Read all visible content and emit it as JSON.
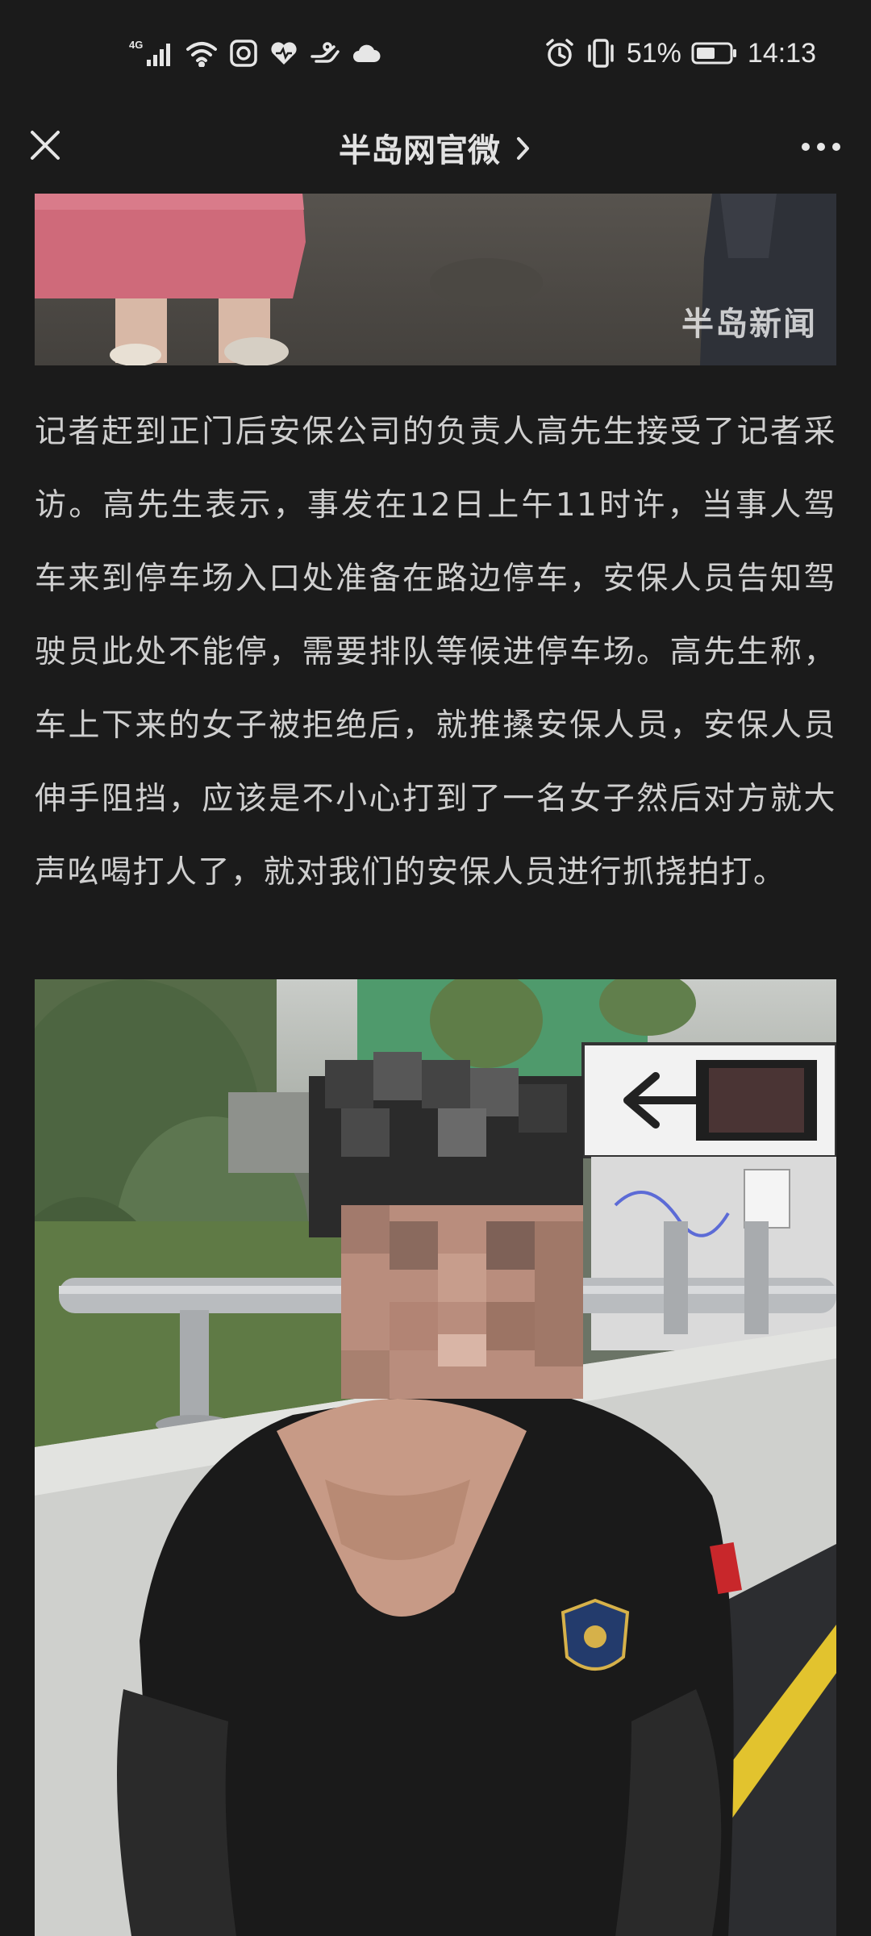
{
  "status_bar": {
    "network": "4G",
    "battery": "51%",
    "time": "14:13"
  },
  "nav": {
    "title": "半岛网官微",
    "icons": [
      "close-icon",
      "chevron-right-icon",
      "more-icon"
    ]
  },
  "article": {
    "top_image_watermark": "半岛新闻",
    "paragraph": "记者赶到正门后安保公司的负责人高先生接受了记者采访。高先生表示，事发在12日上午11时许，当事人驾车来到停车场入口处准备在路边停车，安保人员告知驾驶员此处不能停，需要排队等候进停车场。高先生称，车上下来的女子被拒绝后，就推搡安保人员，安保人员伸手阻挡，应该是不小心打到了一名女子然后对方就大声吆喝打人了，就对我们的安保人员进行抓挠拍打。"
  },
  "colors": {
    "background": "#1b1b1b",
    "text": "#cfcfcf",
    "title": "#e2e2e2"
  }
}
